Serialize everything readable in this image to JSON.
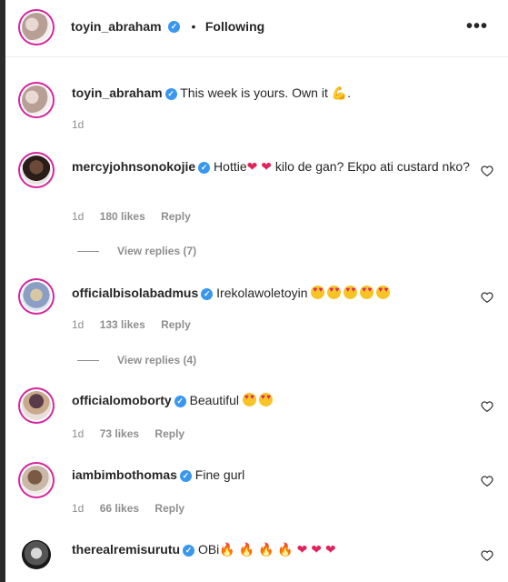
{
  "header": {
    "username": "toyin_abraham",
    "separator": "•",
    "follow_status": "Following",
    "more_icon": "more-horizontal-icon"
  },
  "caption": {
    "username": "toyin_abraham",
    "text": "This week is yours. Own it",
    "emoji": "💪",
    "trailing": ".",
    "time": "1d"
  },
  "comments": [
    {
      "username": "mercyjohnsonokojie",
      "text_parts": [
        "Hottie",
        "❤",
        "❤",
        "kilo de gan? Ekpo ati custard nko?"
      ],
      "time": "1d",
      "likes": "180 likes",
      "reply": "Reply",
      "view_replies": "View replies (7)"
    },
    {
      "username": "officialbisolabadmus",
      "text": "Irekolawoletoyin",
      "emoji_count": 5,
      "time": "1d",
      "likes": "133 likes",
      "reply": "Reply",
      "view_replies": "View replies (4)"
    },
    {
      "username": "officialomoborty",
      "text": "Beautiful",
      "emoji_count": 2,
      "time": "1d",
      "likes": "73 likes",
      "reply": "Reply"
    },
    {
      "username": "iambimbothomas",
      "text": "Fine gurl",
      "time": "1d",
      "likes": "66 likes",
      "reply": "Reply"
    },
    {
      "username": "therealremisurutu",
      "text": "OBi",
      "fire_count": 4,
      "heart_count": 3
    }
  ],
  "colors": {
    "verified": "#3897f0",
    "meta_text": "#8e8e8e",
    "heart_emoji": "#e0245e"
  }
}
